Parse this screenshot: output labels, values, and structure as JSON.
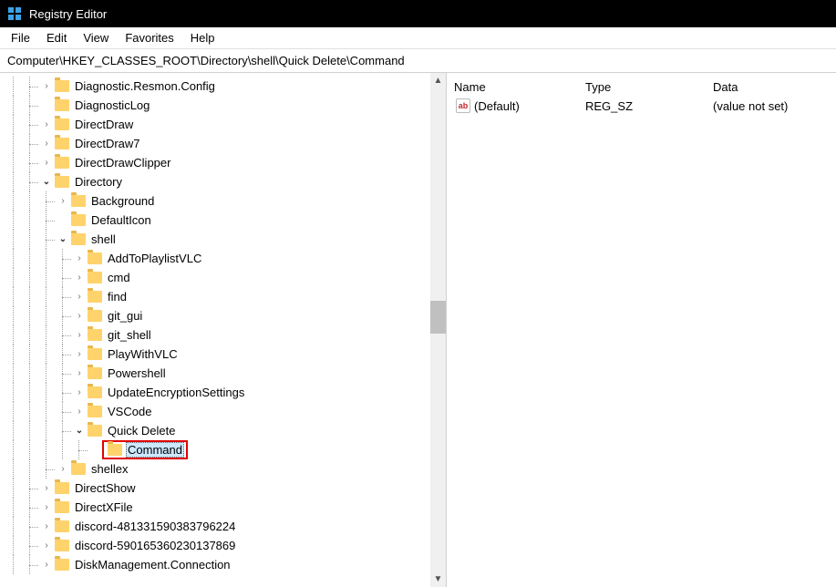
{
  "title": "Registry Editor",
  "menu": [
    "File",
    "Edit",
    "View",
    "Favorites",
    "Help"
  ],
  "address": "Computer\\HKEY_CLASSES_ROOT\\Directory\\shell\\Quick Delete\\Command",
  "tree": [
    {
      "depth": 2,
      "twisty": ">",
      "label": "Diagnostic.Resmon.Config"
    },
    {
      "depth": 2,
      "twisty": "",
      "label": "DiagnosticLog"
    },
    {
      "depth": 2,
      "twisty": ">",
      "label": "DirectDraw"
    },
    {
      "depth": 2,
      "twisty": ">",
      "label": "DirectDraw7"
    },
    {
      "depth": 2,
      "twisty": ">",
      "label": "DirectDrawClipper"
    },
    {
      "depth": 2,
      "twisty": "v",
      "label": "Directory"
    },
    {
      "depth": 3,
      "twisty": ">",
      "label": "Background"
    },
    {
      "depth": 3,
      "twisty": "",
      "label": "DefaultIcon"
    },
    {
      "depth": 3,
      "twisty": "v",
      "label": "shell"
    },
    {
      "depth": 4,
      "twisty": ">",
      "label": "AddToPlaylistVLC"
    },
    {
      "depth": 4,
      "twisty": ">",
      "label": "cmd"
    },
    {
      "depth": 4,
      "twisty": ">",
      "label": "find"
    },
    {
      "depth": 4,
      "twisty": ">",
      "label": "git_gui"
    },
    {
      "depth": 4,
      "twisty": ">",
      "label": "git_shell"
    },
    {
      "depth": 4,
      "twisty": ">",
      "label": "PlayWithVLC"
    },
    {
      "depth": 4,
      "twisty": ">",
      "label": "Powershell"
    },
    {
      "depth": 4,
      "twisty": ">",
      "label": "UpdateEncryptionSettings"
    },
    {
      "depth": 4,
      "twisty": ">",
      "label": "VSCode"
    },
    {
      "depth": 4,
      "twisty": "v",
      "label": "Quick Delete"
    },
    {
      "depth": 5,
      "twisty": "",
      "label": "Command",
      "selected": true,
      "highlight": true
    },
    {
      "depth": 3,
      "twisty": ">",
      "label": "shellex"
    },
    {
      "depth": 2,
      "twisty": ">",
      "label": "DirectShow"
    },
    {
      "depth": 2,
      "twisty": ">",
      "label": "DirectXFile"
    },
    {
      "depth": 2,
      "twisty": ">",
      "label": "discord-481331590383796224"
    },
    {
      "depth": 2,
      "twisty": ">",
      "label": "discord-590165360230137869"
    },
    {
      "depth": 2,
      "twisty": ">",
      "label": "DiskManagement.Connection"
    }
  ],
  "list": {
    "headers": {
      "name": "Name",
      "type": "Type",
      "data": "Data"
    },
    "rows": [
      {
        "icon": "ab",
        "name": "(Default)",
        "type": "REG_SZ",
        "data": "(value not set)"
      }
    ]
  }
}
